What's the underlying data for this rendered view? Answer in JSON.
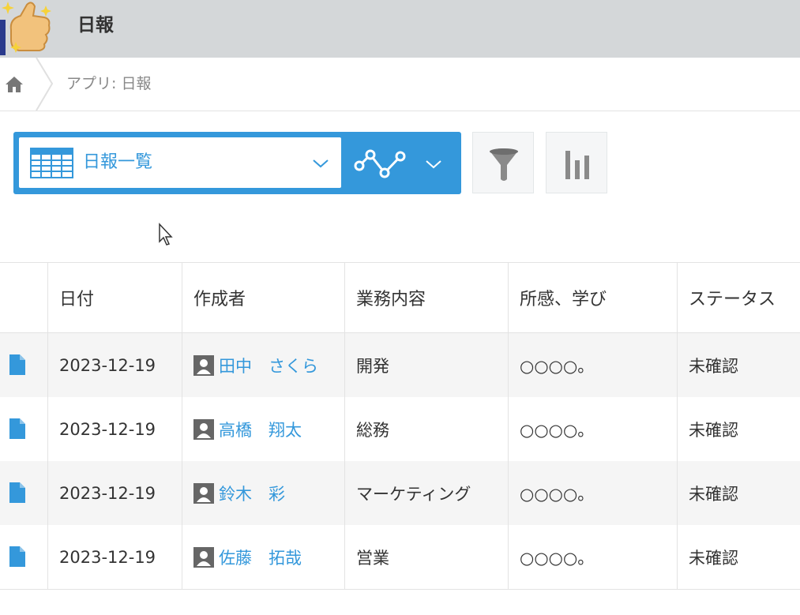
{
  "header": {
    "app_title": "日報"
  },
  "breadcrumb": {
    "text": "アプリ: 日報"
  },
  "view": {
    "selected": "日報一覧"
  },
  "table": {
    "columns": [
      "日付",
      "作成者",
      "業務内容",
      "所感、学び",
      "ステータス"
    ],
    "rows": [
      {
        "date": "2023-12-19",
        "author": "田中　さくら",
        "work": "開発",
        "notes": "○○○○。",
        "status": "未確認"
      },
      {
        "date": "2023-12-19",
        "author": "高橋　翔太",
        "work": "総務",
        "notes": "○○○○。",
        "status": "未確認"
      },
      {
        "date": "2023-12-19",
        "author": "鈴木　彩",
        "work": "マーケティング",
        "notes": "○○○○。",
        "status": "未確認"
      },
      {
        "date": "2023-12-19",
        "author": "佐藤　拓哉",
        "work": "営業",
        "notes": "○○○○。",
        "status": "未確認"
      }
    ]
  },
  "colors": {
    "accent": "#3498db",
    "header_bg": "#d4d7d9",
    "row_alt": "#f5f5f5"
  },
  "icons": [
    "app-icon",
    "home-icon",
    "table-icon",
    "chevron-down-icon",
    "graph-icon",
    "filter-icon",
    "bar-chart-icon",
    "document-icon",
    "user-icon",
    "mouse-cursor-icon"
  ]
}
